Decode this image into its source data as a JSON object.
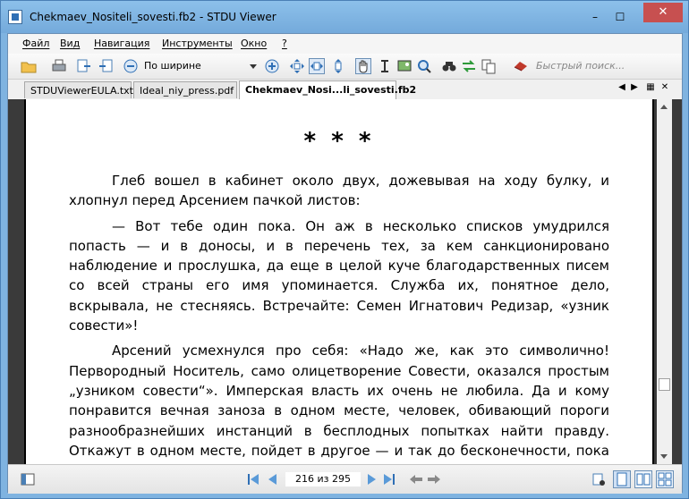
{
  "window": {
    "title": "Chekmaev_Nositeli_sovesti.fb2 - STDU Viewer",
    "minimize_label": "–",
    "maximize_label": "☐",
    "close_label": "✕"
  },
  "menu": [
    "Файл",
    "Вид",
    "Навигация",
    "Инструменты",
    "Окно",
    "?"
  ],
  "toolbar": {
    "zoom_mode": "По ширине",
    "search_placeholder": "Быстрый поиск..."
  },
  "tabs": [
    {
      "label": "STDUViewerEULA.txt",
      "active": false
    },
    {
      "label": "Ideal_niy_press.pdf",
      "active": false
    },
    {
      "label": "Chekmaev_Nosi...li_sovesti.fb2",
      "active": true
    }
  ],
  "document": {
    "heading": "* * *",
    "paragraphs": [
      "Глеб вошел в кабинет около двух, дожевывая на ходу булку, и хлопнул перед Арсением пачкой листов:",
      "— Вот тебе один пока. Он аж в несколько списков умудрился попасть — и в доносы, и в перечень тех, за кем санкционировано наблюдение и прослушка, да еще в целой куче благодарственных писем со всей страны его имя упоминается. Служба их, понятное дело, вскрывала, не стесняясь. Встречайте: Семен Игнатович Редизар, «узник совести»!",
      "Арсений усмехнулся про себя: «Надо же, как это символично! Первородный Носитель, само олицетворение Совести, оказался простым „узником совести“». Имперская власть их очень не любила. Да и кому понравится вечная заноза в одном месте, человек, обивающий пороги разнообразнейших инстанций в бесплодных попытках найти правду. Откажут в одном месте, пойдет в другое — и так до бесконечности, пока не отчается окончательно."
    ]
  },
  "status": {
    "page_indicator": "216 из 295"
  },
  "colors": {
    "titlebar": "#7fb3e0",
    "close": "#c75050",
    "frame": "#f0f0f0"
  }
}
